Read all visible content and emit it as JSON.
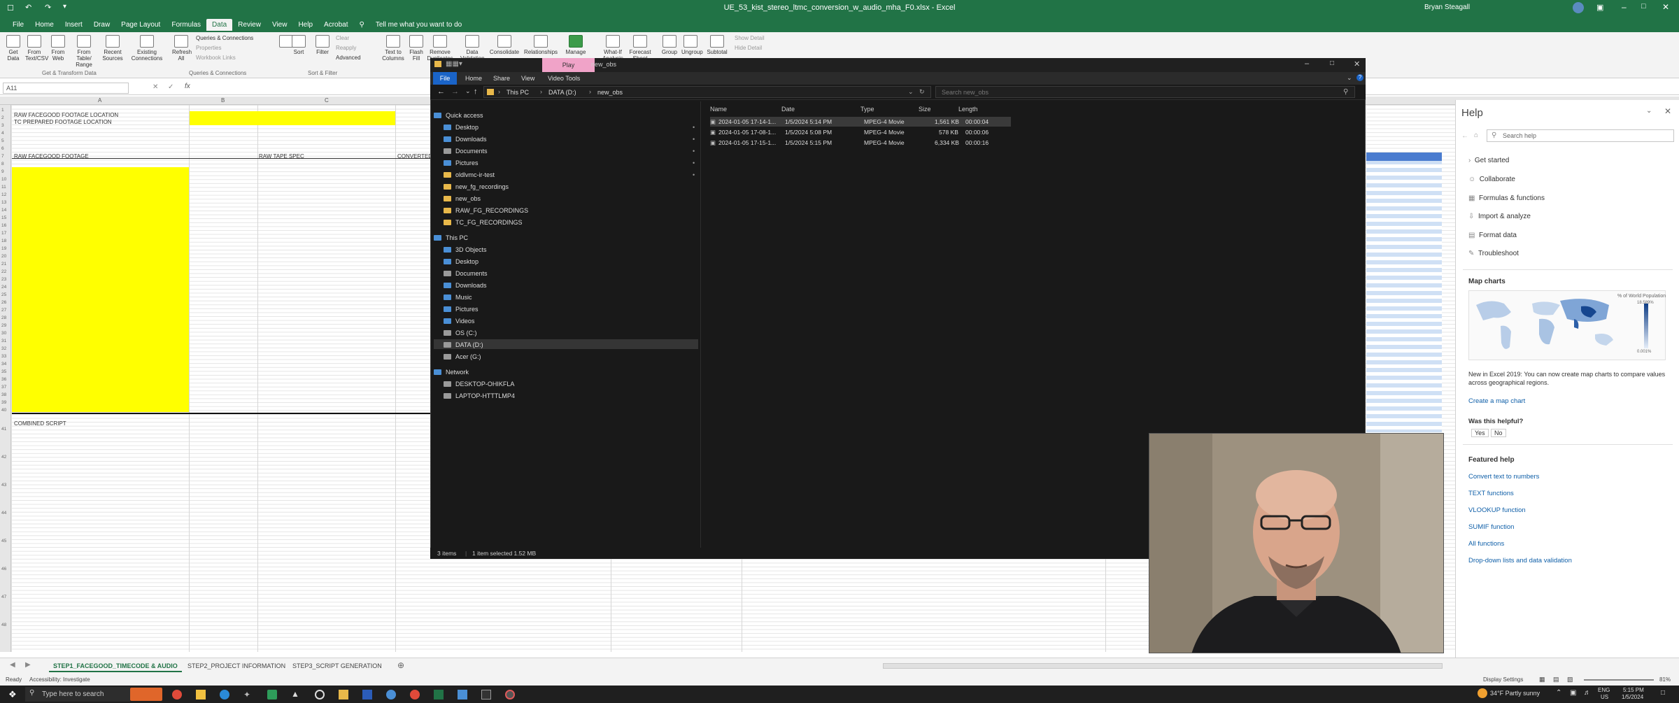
{
  "excel": {
    "title": "UE_53_kist_stereo_ltmc_conversion_w_audio_mha_F0.xlsx - Excel",
    "user": "Bryan Steagall",
    "ribbon_tabs": [
      "File",
      "Home",
      "Insert",
      "Draw",
      "Page Layout",
      "Formulas",
      "Data",
      "Review",
      "View",
      "Help",
      "Acrobat"
    ],
    "active_tab": "Data",
    "tell_me": "Tell me what you want to do",
    "data_ribbon": {
      "get_data": "Get Data",
      "from_text": "From Text/CSV",
      "from_web": "From Web",
      "from_table": "From Table/ Range",
      "recent_sources": "Recent Sources",
      "existing": "Existing Connections",
      "refresh": "Refresh All",
      "queries": "Queries & Connections",
      "properties": "Properties",
      "workbook_links": "Workbook Links",
      "sort": "Sort",
      "filter": "Filter",
      "clear": "Clear",
      "reapply": "Reapply",
      "advanced": "Advanced",
      "text_to_columns": "Text to Columns",
      "flash_fill": "Flash Fill",
      "remove_dup": "Remove Duplicates",
      "data_validation": "Data Validation",
      "consolidate": "Consolidate",
      "relationships": "Relationships",
      "manage": "Manage",
      "what_if": "What-If Analysis",
      "forecast": "Forecast Sheet",
      "group": "Group",
      "ungroup": "Ungroup",
      "subtotal": "Subtotal",
      "show_detail": "Show Detail",
      "hide_detail": "Hide Detail",
      "group1": "Get & Transform Data",
      "group2": "Queries & Connections",
      "group3": "Sort & Filter"
    },
    "name_box": "A11",
    "columns": [
      "A",
      "B",
      "C"
    ],
    "cells": {
      "raw_loc": "RAW FACEGOOD FOOTAGE LOCATION",
      "tc_loc": "TC PREPARED FOOTAGE LOCATION",
      "raw_footage": "RAW FACEGOOD FOOTAGE",
      "raw_tape": "RAW TAPE SPEC",
      "converted": "CONVERTED",
      "combined": "COMBINED SCRIPT"
    },
    "row_numbers": [
      "1",
      "2",
      "3",
      "4",
      "5",
      "6",
      "7",
      "8",
      "9",
      "10",
      "11",
      "12",
      "13",
      "14",
      "15",
      "16",
      "17",
      "18",
      "19",
      "20",
      "21",
      "22",
      "23",
      "24",
      "25",
      "26",
      "27",
      "28",
      "29",
      "30",
      "31",
      "32",
      "33",
      "34",
      "35",
      "36",
      "37",
      "38",
      "39",
      "40",
      "41",
      "42",
      "43",
      "44",
      "45",
      "46",
      "47",
      "48"
    ],
    "sheet_tabs": [
      "STEP1_FACEGOOD_TIMECODE & AUDIO",
      "STEP2_PROJECT INFORMATION",
      "STEP3_SCRIPT GENERATION"
    ],
    "active_sheet": "STEP1_FACEGOOD_TIMECODE & AUDIO",
    "status_ready": "Ready",
    "accessibility": "Accessibility: Investigate",
    "display_settings": "Display Settings",
    "zoom": "81%",
    "accent": "#217346"
  },
  "explorer": {
    "window_title": "new_obs",
    "context_tab": "Play",
    "tabs": [
      "File",
      "Home",
      "Share",
      "View",
      "Video Tools"
    ],
    "breadcrumb": [
      "This PC",
      "DATA (D:)",
      "new_obs"
    ],
    "search_placeholder": "Search new_obs",
    "quick_access_label": "Quick access",
    "quick_access": [
      "Desktop",
      "Downloads",
      "Documents",
      "Pictures",
      "oldlvmc-ir-test",
      "new_fg_recordings",
      "new_obs",
      "RAW_FG_RECORDINGS",
      "TC_FG_RECORDINGS"
    ],
    "this_pc_label": "This PC",
    "this_pc": [
      "3D Objects",
      "Desktop",
      "Documents",
      "Downloads",
      "Music",
      "Pictures",
      "Videos",
      "OS (C:)",
      "DATA (D:)",
      "Acer (G:)"
    ],
    "network_label": "Network",
    "network": [
      "DESKTOP-OHIKFLA",
      "LAPTOP-HTTTLMP4"
    ],
    "columns": [
      "Name",
      "Date",
      "Type",
      "Size",
      "Length"
    ],
    "files": [
      {
        "name": "2024-01-05 17-14-1...",
        "date": "1/5/2024 5:14 PM",
        "type": "MPEG-4 Movie",
        "size": "1,561 KB",
        "length": "00:00:04"
      },
      {
        "name": "2024-01-05 17-08-1...",
        "date": "1/5/2024 5:08 PM",
        "type": "MPEG-4 Movie",
        "size": "578 KB",
        "length": "00:00:06"
      },
      {
        "name": "2024-01-05 17-15-1...",
        "date": "1/5/2024 5:15 PM",
        "type": "MPEG-4 Movie",
        "size": "6,334 KB",
        "length": "00:00:16"
      }
    ],
    "status": "3 items",
    "selection": "1 item selected  1.52 MB"
  },
  "help": {
    "title": "Help",
    "search_placeholder": "Search help",
    "items": [
      "Get started",
      "Collaborate",
      "Formulas & functions",
      "Import & analyze",
      "Format data",
      "Troubleshoot"
    ],
    "map_title": "Map charts",
    "map_legend": "% of World Population",
    "map_max": "18.589%",
    "map_min": "0.001%",
    "map_desc": "New in Excel 2019: You can now create map charts to compare values across geographical regions.",
    "map_link": "Create a map chart",
    "helpful": "Was this helpful?",
    "yes": "Yes",
    "no": "No",
    "featured_title": "Featured help",
    "featured": [
      "Convert text to numbers",
      "TEXT functions",
      "VLOOKUP function",
      "SUMIF function",
      "All functions",
      "Drop-down lists and data validation"
    ]
  },
  "taskbar": {
    "search": "Type here to search",
    "weather": "34°F  Partly sunny",
    "lang": "ENG",
    "region": "US",
    "time": "5:15 PM",
    "date": "1/5/2024"
  }
}
